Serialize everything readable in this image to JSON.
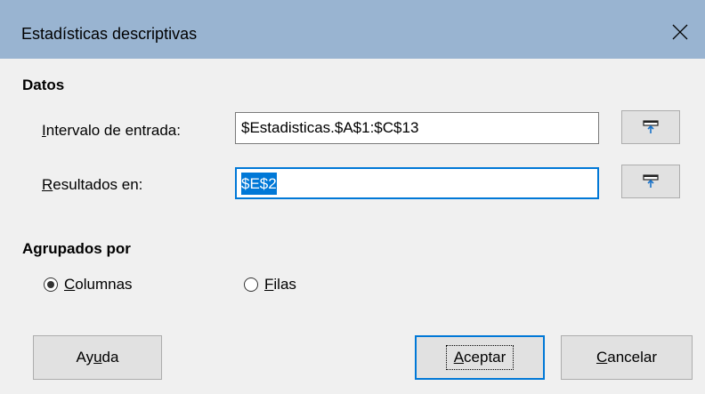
{
  "window": {
    "title": "Estadísticas descriptivas",
    "close_label": "close"
  },
  "datos": {
    "heading": "Datos",
    "input_range": {
      "label_prefix": "",
      "label_accel": "I",
      "label_rest": "ntervalo de entrada:",
      "value": "$Estadisticas.$A$1:$C$13"
    },
    "results": {
      "label_accel": "R",
      "label_rest": "esultados en:",
      "value": "$E$2"
    }
  },
  "grouped": {
    "heading": "Agrupados por",
    "columns": {
      "accel": "C",
      "rest": "olumnas",
      "selected": true
    },
    "rows": {
      "accel": "F",
      "rest": "ilas",
      "selected": false
    }
  },
  "buttons": {
    "help": {
      "pre": "Ay",
      "accel": "u",
      "post": "da"
    },
    "ok": {
      "accel": "A",
      "rest": "ceptar"
    },
    "cancel": {
      "accel": "C",
      "rest": "ancelar"
    }
  },
  "icons": {
    "shrink": "shrink-dialog-icon",
    "close": "close-icon"
  },
  "colors": {
    "titlebar": "#99b4d1",
    "accent": "#0078d7",
    "button_bg": "#e1e1e1",
    "dialog_bg": "#f0f0f0"
  }
}
